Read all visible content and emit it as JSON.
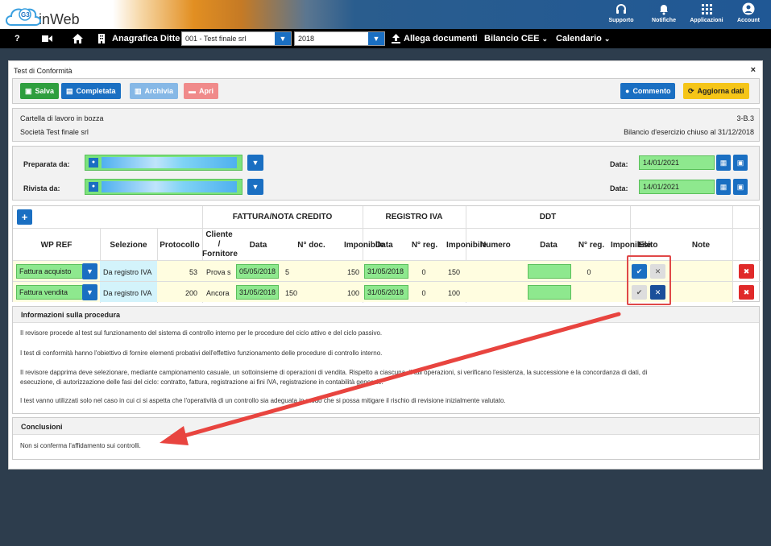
{
  "brand": {
    "name": "inWeb",
    "badge": "G3"
  },
  "topbar": {
    "items": [
      {
        "label": "Supporto",
        "icon": "headset-icon"
      },
      {
        "label": "Notifiche",
        "icon": "bell-icon"
      },
      {
        "label": "Applicazioni",
        "icon": "grid-icon"
      },
      {
        "label": "Account",
        "icon": "user-circle-icon"
      }
    ]
  },
  "navbar": {
    "help": "?",
    "anagrafica": "Anagrafica Ditte",
    "company_select": "001 - Test finale srl",
    "year_select": "2018",
    "allega": "Allega documenti",
    "bilancio": "Bilancio CEE",
    "calendario": "Calendario"
  },
  "panel": {
    "title": "Test di Conformità",
    "close": "×",
    "buttons": {
      "salva": "Salva",
      "completata": "Completata",
      "archivia": "Archivia",
      "apri": "Apri",
      "commento": "Commento",
      "aggiorna": "Aggiorna dati"
    },
    "info": {
      "status": "Cartella di lavoro in bozza",
      "code": "3-B.3",
      "company": "Società Test finale srl",
      "bilancio": "Bilancio d'esercizio chiuso al 31/12/2018"
    },
    "prep": {
      "preparata_label": "Preparata da:",
      "rivista_label": "Rivista da:",
      "data_label": "Data:",
      "data1": "14/01/2021",
      "data2": "14/01/2021"
    },
    "table": {
      "add": "+",
      "groups": {
        "fattura": "FATTURA/NOTA CREDITO",
        "registro": "REGISTRO IVA",
        "ddt": "DDT"
      },
      "headers": {
        "wpref": "WP REF",
        "selezione": "Selezione",
        "protocollo": "Protocollo",
        "cliente1": "Cliente",
        "cliente2": "/",
        "cliente3": "Fornitore",
        "data": "Data",
        "ndoc": "N° doc.",
        "imponibile": "Imponibile",
        "rdata": "Data",
        "nreg": "N° reg.",
        "rimponibile": "Imponibile",
        "numero": "Numero",
        "ddata": "Data",
        "dnreg": "N° reg.",
        "dimponibile": "Imponibile",
        "esito": "Esito",
        "note": "Note"
      },
      "rows": [
        {
          "wpref": "Fattura acquisto",
          "selezione": "Da registro IVA",
          "protocollo": "53",
          "cliente": "Prova s",
          "data": "05/05/2018",
          "ndoc": "5",
          "imponibile": "150",
          "rdata": "31/05/2018",
          "nreg": "0",
          "rimponibile": "150",
          "dnreg": "0"
        },
        {
          "wpref": "Fattura vendita",
          "selezione": "Da registro IVA",
          "protocollo": "200",
          "cliente": "Ancora",
          "data": "31/05/2018",
          "ndoc": "150",
          "imponibile": "100",
          "rdata": "31/05/2018",
          "nreg": "0",
          "rimponibile": "100",
          "dnreg": ""
        }
      ]
    },
    "procedura": {
      "title": "Informazioni sulla procedura",
      "p1": "Il revisore procede al test sul funzionamento del sistema di controllo interno per le procedure del ciclo attivo e del ciclo passivo.",
      "p2": "I test di conformità hanno l'obiettivo di fornire elementi probativi dell'effettivo funzionamento delle procedure di controllo interno.",
      "p3a": "Il revisore dapprima deve selezionare, mediante campionamento casuale, un sottoinsieme di operazioni di vendita. Rispetto a ciascuna di tali operazioni, si verificano l'esistenza, la successione e la concordanza di dati, di",
      "p3b": "esecuzione, di autorizzazione delle fasi del ciclo: contratto, fattura, registrazione ai fini IVA, registrazione in contabilità generale.",
      "p4": "I test vanno utilizzati solo nel caso in cui ci si aspetta che l'operatività di un controllo sia adeguata in modo che si possa mitigare il rischio di revisione inizialmente valutato."
    },
    "conclusioni": {
      "title": "Conclusioni",
      "text": "Non si conferma l'affidamento sui controlli."
    }
  }
}
